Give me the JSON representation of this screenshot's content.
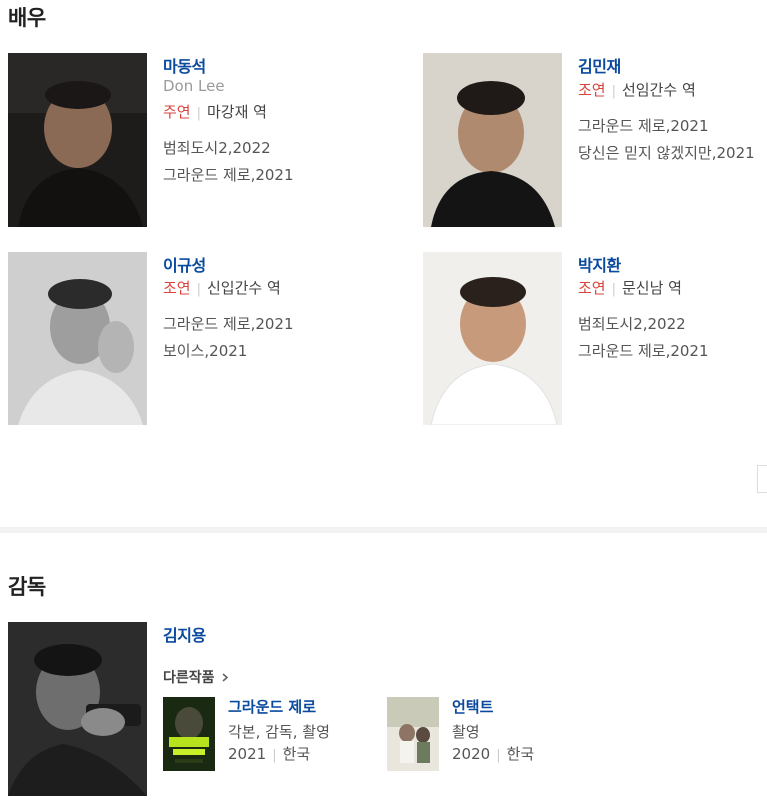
{
  "cast": {
    "title": "배우",
    "actors": [
      {
        "name": "마동석",
        "english_name": "Don Lee",
        "role_type": "주연",
        "character": "마강재 역",
        "works": [
          "범죄도시2,2022",
          "그라운드 제로,2021"
        ]
      },
      {
        "name": "김민재",
        "english_name": "",
        "role_type": "조연",
        "character": "선임간수 역",
        "works": [
          "그라운드 제로,2021",
          "당신은 믿지 않겠지만,2021"
        ]
      },
      {
        "name": "이규성",
        "english_name": "",
        "role_type": "조연",
        "character": "신입간수 역",
        "works": [
          "그라운드 제로,2021",
          "보이스,2021"
        ]
      },
      {
        "name": "박지환",
        "english_name": "",
        "role_type": "조연",
        "character": "문신남 역",
        "works": [
          "범죄도시2,2022",
          "그라운드 제로,2021"
        ]
      }
    ]
  },
  "director": {
    "title": "감독",
    "name": "김지용",
    "other_works_label": "다른작품",
    "films": [
      {
        "title": "그라운드 제로",
        "roles": "각본, 감독, 촬영",
        "year": "2021",
        "country": "한국"
      },
      {
        "title": "언택트",
        "roles": "촬영",
        "year": "2020",
        "country": "한국"
      }
    ]
  },
  "icons": {
    "other_works_arrow": "chevron-right-icon"
  },
  "colors": {
    "name_link": "#0a4a9e",
    "role_type": "#d9453d",
    "section_divider": "#f2f2f2"
  }
}
